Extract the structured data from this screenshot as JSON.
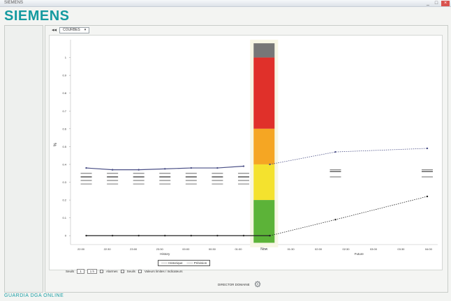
{
  "window": {
    "title": "SIEMENS",
    "buttons": [
      "_",
      "□",
      "×"
    ]
  },
  "brand": {
    "name": "SIEMENS"
  },
  "toolbar": {
    "nav": "◂◂",
    "dropdown_value": "COURBES"
  },
  "legend": {
    "items": [
      "—— Historique",
      "—— Prévision"
    ]
  },
  "controls": {
    "label": "Seuils",
    "select_a": "1",
    "select_b": "1 h",
    "options": [
      "Alarmes",
      "Seuils",
      "Valeurs limites / Indicateurs"
    ]
  },
  "action": {
    "label": "DIRECTOR DOMAINE"
  },
  "footer": {
    "text": "GUARDIA DGA ONLINE"
  },
  "chart_data": {
    "type": "line",
    "title": "",
    "xlabel_history": "History",
    "xlabel_future": "Future",
    "now_label": "Now",
    "ylabel": "%",
    "ylim": [
      -0.05,
      1.1
    ],
    "yticks": [
      0,
      0.1,
      0.2,
      0.3,
      0.4,
      0.5,
      0.6,
      0.7,
      0.8,
      0.9,
      1
    ],
    "history_ticks": [
      "22:00",
      "22:30",
      "23:00",
      "23:30",
      "00:00",
      "00:30",
      "01:00"
    ],
    "future_ticks": [
      "01:30",
      "02:00",
      "02:30",
      "03:00",
      "03:30",
      "04:00"
    ],
    "gauge": {
      "red_from": 0.6,
      "orange_from": 0.4,
      "yellow_from": 0.2,
      "green_from": 0,
      "top": 1.08,
      "colors": {
        "red": "#e0302a",
        "orange": "#f5a623",
        "yellow": "#f4e22e",
        "green": "#5cb338",
        "cap": "#777777"
      }
    },
    "series": [
      {
        "name": "Historique",
        "color": "#4a4f86",
        "x": [
          0,
          1,
          2,
          3,
          4,
          5,
          6
        ],
        "values": [
          0.38,
          0.37,
          0.37,
          0.375,
          0.38,
          0.38,
          0.39
        ]
      },
      {
        "name": "Prévision",
        "color": "#4a4f86",
        "dashed": true,
        "x": [
          7,
          9.5,
          13
        ],
        "values": [
          0.4,
          0.47,
          0.49
        ]
      },
      {
        "name": "Historique",
        "color": "#222222",
        "x": [
          0,
          1,
          2,
          3,
          4,
          5,
          6,
          7
        ],
        "values": [
          0,
          0,
          0,
          0,
          0,
          0,
          0,
          0
        ]
      },
      {
        "name": "Prévision",
        "color": "#222222",
        "dashed": true,
        "x": [
          7,
          9.5,
          13
        ],
        "values": [
          0,
          0.09,
          0.22
        ]
      }
    ],
    "threshold_bars": [
      {
        "x": [
          0,
          1,
          2,
          3,
          4,
          5,
          6
        ],
        "values": [
          0.35,
          0.33,
          0.31,
          0.29
        ]
      },
      {
        "x": [
          9.5,
          13
        ],
        "values": [
          0.37,
          0.36,
          0.33
        ]
      }
    ]
  }
}
